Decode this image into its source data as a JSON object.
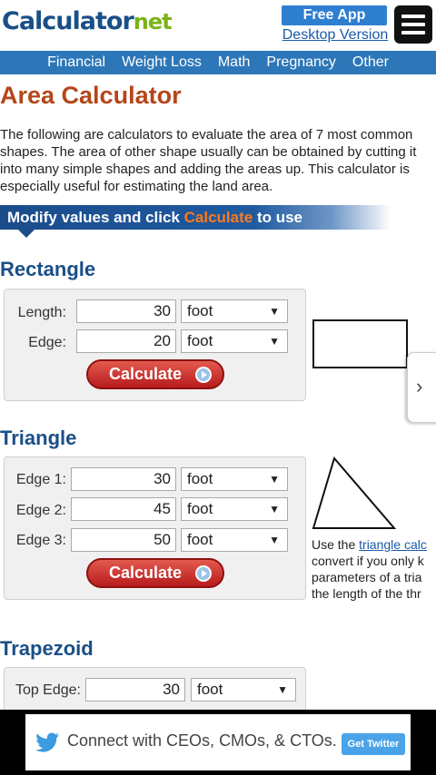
{
  "header": {
    "logo_main": "Calculator",
    "logo_net": "net",
    "free_app": "Free App",
    "desktop_version": "Desktop Version"
  },
  "nav": [
    "Financial",
    "Weight Loss",
    "Math",
    "Pregnancy",
    "Other"
  ],
  "page": {
    "title": "Area Calculator",
    "intro": "The following are calculators to evaluate the area of 7 most common shapes. The area of other shape usually can be obtained by cutting it into many simple shapes and adding the areas up. This calculator is especially useful for estimating the land area.",
    "banner_prefix": "Modify values and click ",
    "banner_highlight": "Calculate",
    "banner_suffix": " to use"
  },
  "rectangle": {
    "title": "Rectangle",
    "length_label": "Length:",
    "length_value": "30",
    "length_unit": "foot",
    "edge_label": "Edge:",
    "edge_value": "20",
    "edge_unit": "foot",
    "button": "Calculate"
  },
  "triangle": {
    "title": "Triangle",
    "edge1_label": "Edge 1:",
    "edge1_value": "30",
    "edge1_unit": "foot",
    "edge2_label": "Edge 2:",
    "edge2_value": "45",
    "edge2_unit": "foot",
    "edge3_label": "Edge 3:",
    "edge3_value": "50",
    "edge3_unit": "foot",
    "button": "Calculate",
    "note_line1_prefix": "Use the ",
    "note_line1_link": "triangle calc",
    "note_line2": "convert if you only k",
    "note_line3": "parameters of a tria",
    "note_line4": "the length of the thr"
  },
  "trapezoid": {
    "title": "Trapezoid",
    "top_edge_label": "Top Edge:",
    "top_edge_value": "30",
    "top_edge_unit": "foot"
  },
  "ad": {
    "text": "Connect with CEOs, CMOs, & CTOs.",
    "button": "Get Twitter"
  },
  "colors": {
    "brand_blue": "#1a4f87",
    "nav_blue": "#2d77b8",
    "title_orange": "#b5461a",
    "button_red": "#c62828",
    "logo_green": "#7ab317"
  },
  "icons": {
    "menu": "hamburger-icon",
    "next": "chevron-right-icon",
    "ad": "twitter-bird-icon",
    "calc_go": "arrow-circle-icon"
  }
}
